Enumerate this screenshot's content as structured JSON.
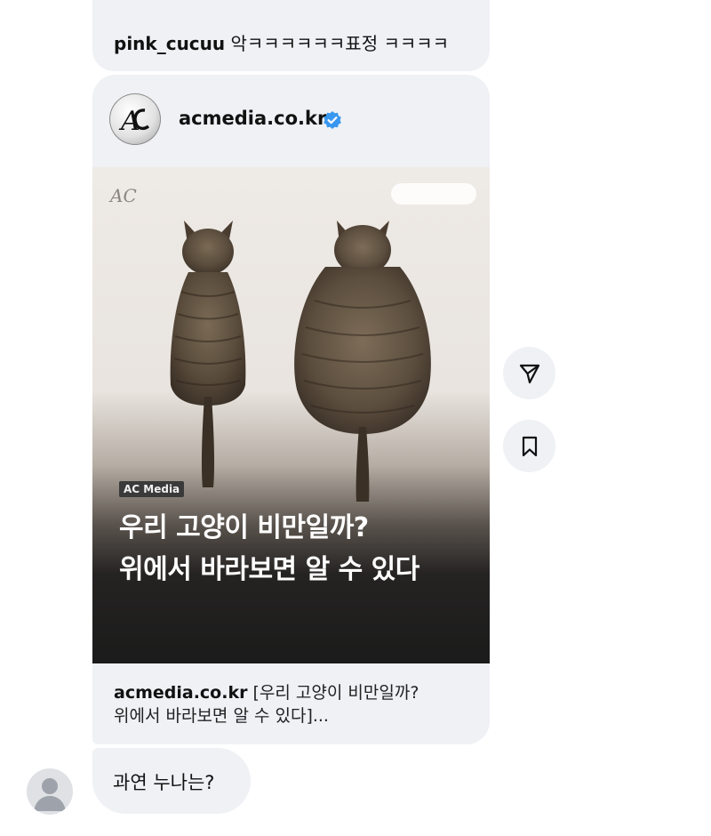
{
  "prev_message": {
    "username": "pink_cucuu",
    "text": "악ㅋㅋㅋㅋㅋㅋ표정 ㅋㅋㅋㅋ"
  },
  "shared_post": {
    "author": "acmedia.co.kr",
    "verified": true,
    "image": {
      "logo_text": "AC",
      "tag": "AC Media",
      "headline_line1": "우리 고양이 비만일까?",
      "headline_line2": "위에서 바라보면 알 수 있다"
    },
    "caption_source": "acmedia.co.kr",
    "caption_line1_text": "[우리 고양이 비만일까?",
    "caption_line2": "위에서 바라보면 알 수 있다]..."
  },
  "actions": {
    "share_icon": "send-icon",
    "save_icon": "bookmark-icon"
  },
  "last_message": {
    "text": "과연 누나는?"
  },
  "colors": {
    "bubble": "#eff1f5",
    "verified": "#3897f0"
  }
}
